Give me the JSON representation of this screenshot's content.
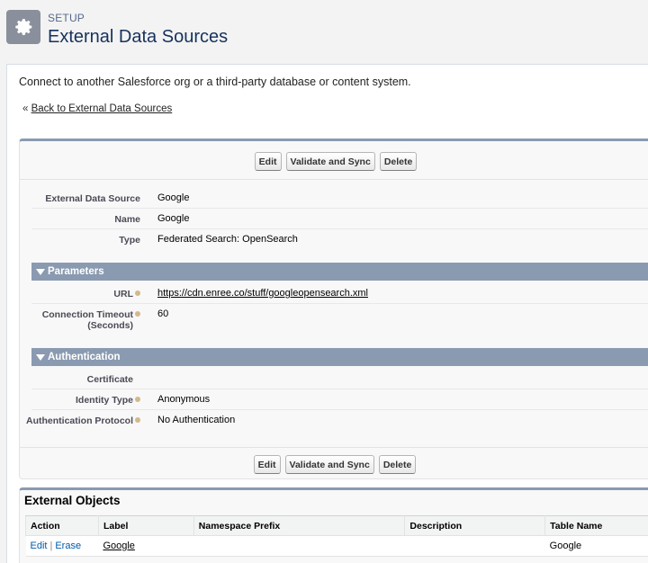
{
  "header": {
    "icon": "gear-icon",
    "setup_label": "SETUP",
    "title": "External Data Sources"
  },
  "description": "Connect to another Salesforce org or a third-party database or content system.",
  "back_prefix": "«",
  "back_link": "Back to External Data Sources",
  "buttons": {
    "edit": "Edit",
    "validate": "Validate and Sync",
    "delete": "Delete"
  },
  "details": [
    {
      "label": "External Data Source",
      "value": "Google"
    },
    {
      "label": "Name",
      "value": "Google"
    },
    {
      "label": "Type",
      "value": "Federated Search: OpenSearch"
    }
  ],
  "parameters": {
    "title": "Parameters",
    "url_label": "URL",
    "url_value": "https://cdn.enree.co/stuff/googleopensearch.xml",
    "timeout_label_1": "Connection Timeout",
    "timeout_label_2": "(Seconds)",
    "timeout_value": "60"
  },
  "authentication": {
    "title": "Authentication",
    "certificate_label": "Certificate",
    "certificate_value": "",
    "identity_label": "Identity Type",
    "identity_value": "Anonymous",
    "protocol_label": "Authentication Protocol",
    "protocol_value": "No Authentication"
  },
  "external_objects": {
    "title": "External Objects",
    "columns": [
      "Action",
      "Label",
      "Namespace Prefix",
      "Description",
      "Table Name"
    ],
    "rows": [
      {
        "edit": "Edit",
        "separator": "|",
        "erase": "Erase",
        "label": "Google",
        "namespace": "",
        "description": "",
        "table_name": "Google"
      }
    ]
  },
  "colors": {
    "section_header": "#8a9ab0",
    "link_blue": "#015ba7",
    "help_icon": "#d3b98a"
  }
}
